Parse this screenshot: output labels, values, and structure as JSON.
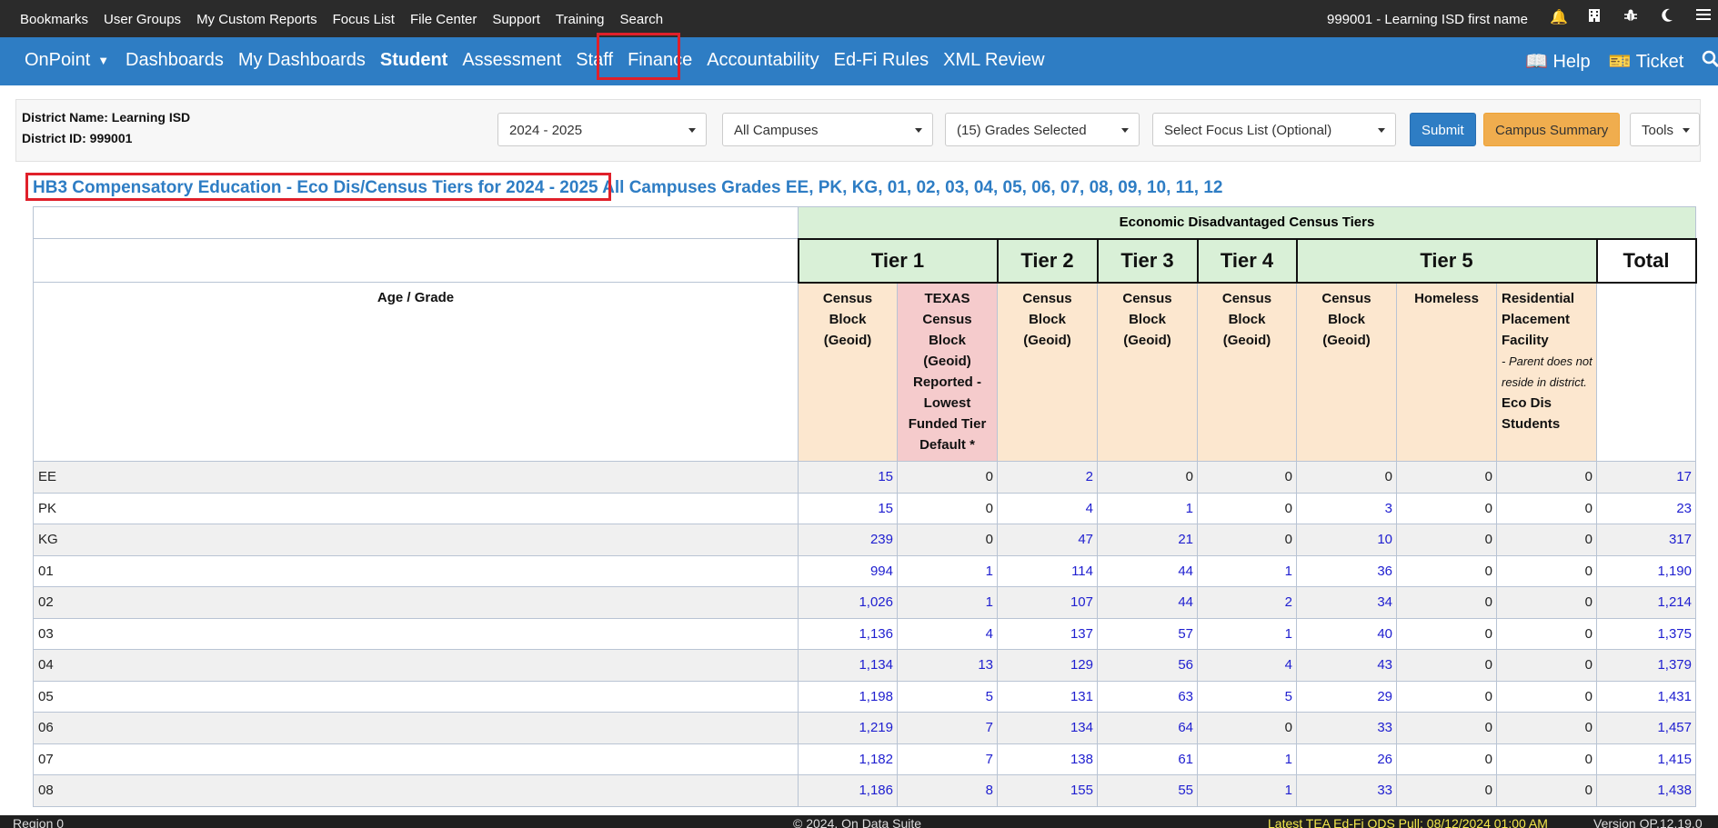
{
  "topbar": {
    "links": [
      "Bookmarks",
      "User Groups",
      "My Custom Reports",
      "Focus List",
      "File Center",
      "Support",
      "Training",
      "Search"
    ],
    "user": "999001 - Learning ISD first name",
    "icons": [
      "bell-icon",
      "building-icon",
      "bug-icon",
      "moon-icon",
      "menu-icon"
    ]
  },
  "navbar": {
    "brand": "OnPoint",
    "items": [
      "Dashboards",
      "My Dashboards",
      "Student",
      "Assessment",
      "Staff",
      "Finance",
      "Accountability",
      "Ed-Fi Rules",
      "XML Review"
    ],
    "help": "Help",
    "ticket": "Ticket"
  },
  "controls": {
    "district_name": "District Name: Learning ISD",
    "district_id": "District ID: 999001",
    "year": "2024 - 2025",
    "campus": "All Campuses",
    "grades": "(15) Grades Selected",
    "focus": "Select Focus List (Optional)",
    "submit": "Submit",
    "campus_summary": "Campus Summary",
    "tools": "Tools"
  },
  "report": {
    "title": "HB3 Compensatory Education - Eco Dis/Census Tiers for 2024 - 2025",
    "subtitle": "All Campuses Grades EE, PK, KG, 01, 02, 03, 04, 05, 06, 07, 08, 09, 10, 11, 12"
  },
  "table": {
    "group_header": "Economic Disadvantaged Census Tiers",
    "tiers": [
      "Tier 1",
      "Tier 2",
      "Tier 3",
      "Tier 4",
      "Tier 5"
    ],
    "total": "Total",
    "age_grade": "Age / Grade",
    "census_block": "Census Block (Geoid)",
    "texas_block": "TEXAS Census Block (Geoid) Reported - Lowest Funded Tier Default *",
    "homeless": "Homeless",
    "residential": "Residential Placement Facility",
    "residential_note": "- Parent does not reside in district.",
    "eco_dis": "Eco Dis Students",
    "rows": [
      {
        "grade": "EE",
        "t1": "15",
        "tx": "0",
        "t2": "2",
        "t3": "0",
        "t4": "0",
        "t5": "0",
        "home": "0",
        "res": "0",
        "total": "17"
      },
      {
        "grade": "PK",
        "t1": "15",
        "tx": "0",
        "t2": "4",
        "t3": "1",
        "t4": "0",
        "t5": "3",
        "home": "0",
        "res": "0",
        "total": "23"
      },
      {
        "grade": "KG",
        "t1": "239",
        "tx": "0",
        "t2": "47",
        "t3": "21",
        "t4": "0",
        "t5": "10",
        "home": "0",
        "res": "0",
        "total": "317"
      },
      {
        "grade": "01",
        "t1": "994",
        "tx": "1",
        "t2": "114",
        "t3": "44",
        "t4": "1",
        "t5": "36",
        "home": "0",
        "res": "0",
        "total": "1,190"
      },
      {
        "grade": "02",
        "t1": "1,026",
        "tx": "1",
        "t2": "107",
        "t3": "44",
        "t4": "2",
        "t5": "34",
        "home": "0",
        "res": "0",
        "total": "1,214"
      },
      {
        "grade": "03",
        "t1": "1,136",
        "tx": "4",
        "t2": "137",
        "t3": "57",
        "t4": "1",
        "t5": "40",
        "home": "0",
        "res": "0",
        "total": "1,375"
      },
      {
        "grade": "04",
        "t1": "1,134",
        "tx": "13",
        "t2": "129",
        "t3": "56",
        "t4": "4",
        "t5": "43",
        "home": "0",
        "res": "0",
        "total": "1,379"
      },
      {
        "grade": "05",
        "t1": "1,198",
        "tx": "5",
        "t2": "131",
        "t3": "63",
        "t4": "5",
        "t5": "29",
        "home": "0",
        "res": "0",
        "total": "1,431"
      },
      {
        "grade": "06",
        "t1": "1,219",
        "tx": "7",
        "t2": "134",
        "t3": "64",
        "t4": "0",
        "t5": "33",
        "home": "0",
        "res": "0",
        "total": "1,457"
      },
      {
        "grade": "07",
        "t1": "1,182",
        "tx": "7",
        "t2": "138",
        "t3": "61",
        "t4": "1",
        "t5": "26",
        "home": "0",
        "res": "0",
        "total": "1,415"
      },
      {
        "grade": "08",
        "t1": "1,186",
        "tx": "8",
        "t2": "155",
        "t3": "55",
        "t4": "1",
        "t5": "33",
        "home": "0",
        "res": "0",
        "total": "1,438"
      }
    ]
  },
  "footer": {
    "left": "Region 0",
    "center": "© 2024, On Data Suite",
    "right_highlight": "Latest TEA Ed-Fi ODS Pull: 08/12/2024 01:00 AM",
    "version": "Version OP.12.19.0"
  }
}
